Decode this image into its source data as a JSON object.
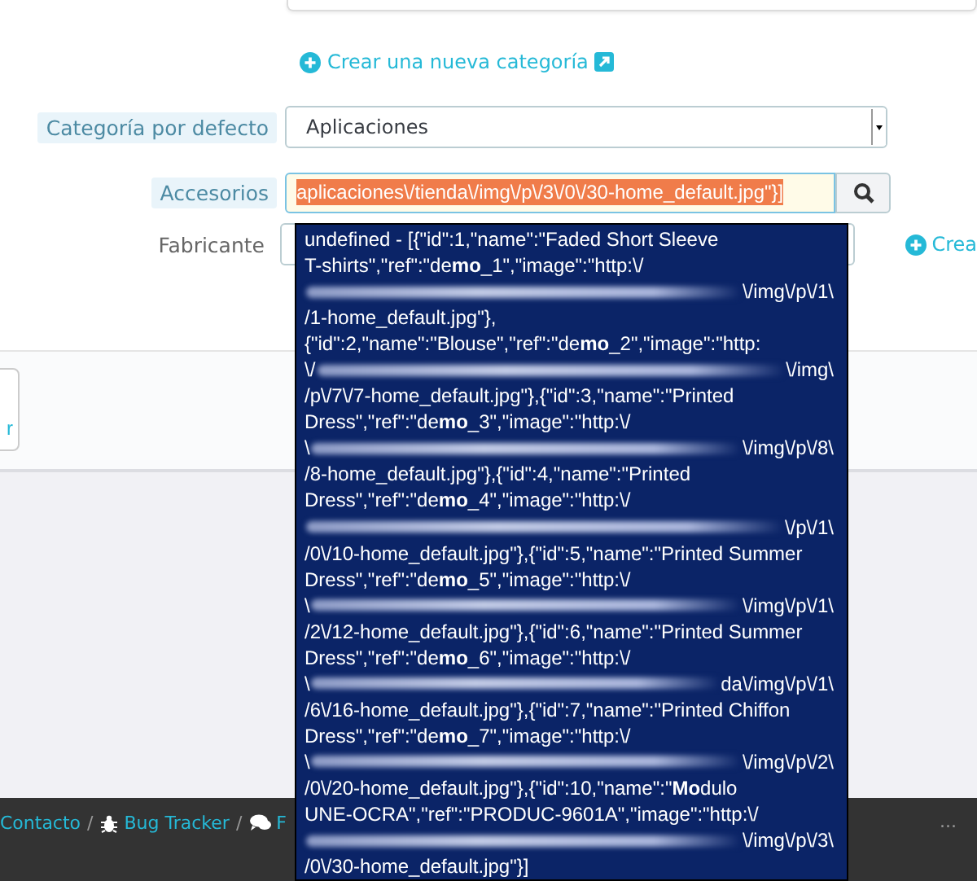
{
  "new_category_link": "Crear una nueva categoría",
  "default_category": {
    "label": "Categoría por defecto",
    "value": "Aplicaciones"
  },
  "accessories": {
    "label": "Accesorios",
    "value": "aplicaciones\\/tienda\\/img\\/p\\/3\\/0\\/30-home_default.jpg\"}]"
  },
  "manufacturer": {
    "label": "Fabricante",
    "create_link": "Crea"
  },
  "panel_button": "r",
  "suggestions": [
    {
      "kind": "text",
      "text": "undefined - [{\"id\":1,\"name\":\"Faded Short Sleeve"
    },
    {
      "kind": "text",
      "text": "T-shirts\",\"ref\":\"de**mo**_1\",\"image\":\"http:\\/"
    },
    {
      "kind": "redacted",
      "end": "\\/img\\/p\\/1\\"
    },
    {
      "kind": "text",
      "text": "/1-home_default.jpg\"},"
    },
    {
      "kind": "text",
      "text": "{\"id\":2,\"name\":\"Blouse\",\"ref\":\"de**mo**_2\",\"image\":\"http:"
    },
    {
      "kind": "redacted",
      "start": "\\/",
      "end": "\\/img\\"
    },
    {
      "kind": "text",
      "text": "/p\\/7\\/7-home_default.jpg\"},{\"id\":3,\"name\":\"Printed"
    },
    {
      "kind": "text",
      "text": "Dress\",\"ref\":\"de**mo**_3\",\"image\":\"http:\\/"
    },
    {
      "kind": "redacted",
      "start": "\\",
      "end": "\\/img\\/p\\/8\\"
    },
    {
      "kind": "text",
      "text": "/8-home_default.jpg\"},{\"id\":4,\"name\":\"Printed"
    },
    {
      "kind": "text",
      "text": "Dress\",\"ref\":\"de**mo**_4\",\"image\":\"http:\\/"
    },
    {
      "kind": "redacted",
      "end": "\\/p\\/1\\"
    },
    {
      "kind": "text",
      "text": "/0\\/10-home_default.jpg\"},{\"id\":5,\"name\":\"Printed Summer"
    },
    {
      "kind": "text",
      "text": "Dress\",\"ref\":\"de**mo**_5\",\"image\":\"http:\\/"
    },
    {
      "kind": "redacted",
      "start": "\\",
      "end": "\\/img\\/p\\/1\\"
    },
    {
      "kind": "text",
      "text": "/2\\/12-home_default.jpg\"},{\"id\":6,\"name\":\"Printed Summer"
    },
    {
      "kind": "text",
      "text": "Dress\",\"ref\":\"de**mo**_6\",\"image\":\"http:\\/"
    },
    {
      "kind": "redacted",
      "start": "\\",
      "end": "da\\/img\\/p\\/1\\"
    },
    {
      "kind": "text",
      "text": "/6\\/16-home_default.jpg\"},{\"id\":7,\"name\":\"Printed Chiffon"
    },
    {
      "kind": "text",
      "text": "Dress\",\"ref\":\"de**mo**_7\",\"image\":\"http:\\/"
    },
    {
      "kind": "redacted",
      "start": "\\",
      "end": "\\/img\\/p\\/2\\"
    },
    {
      "kind": "text",
      "text": "/0\\/20-home_default.jpg\"},{\"id\":10,\"name\":\"**Mo**dulo"
    },
    {
      "kind": "text",
      "text": "UNE-OCRA\",\"ref\":\"PRODUC-9601A\",\"image\":\"http:\\/"
    },
    {
      "kind": "redacted",
      "end": "\\/img\\/p\\/3\\"
    },
    {
      "kind": "text",
      "text": "/0\\/30-home_default.jpg\"}]"
    }
  ],
  "footer": {
    "links": [
      {
        "kind": "plain",
        "label": "Contacto"
      },
      {
        "kind": "bug",
        "label": "Bug Tracker"
      },
      {
        "kind": "chat",
        "label": "F"
      }
    ],
    "separator": "/",
    "more": "..."
  }
}
